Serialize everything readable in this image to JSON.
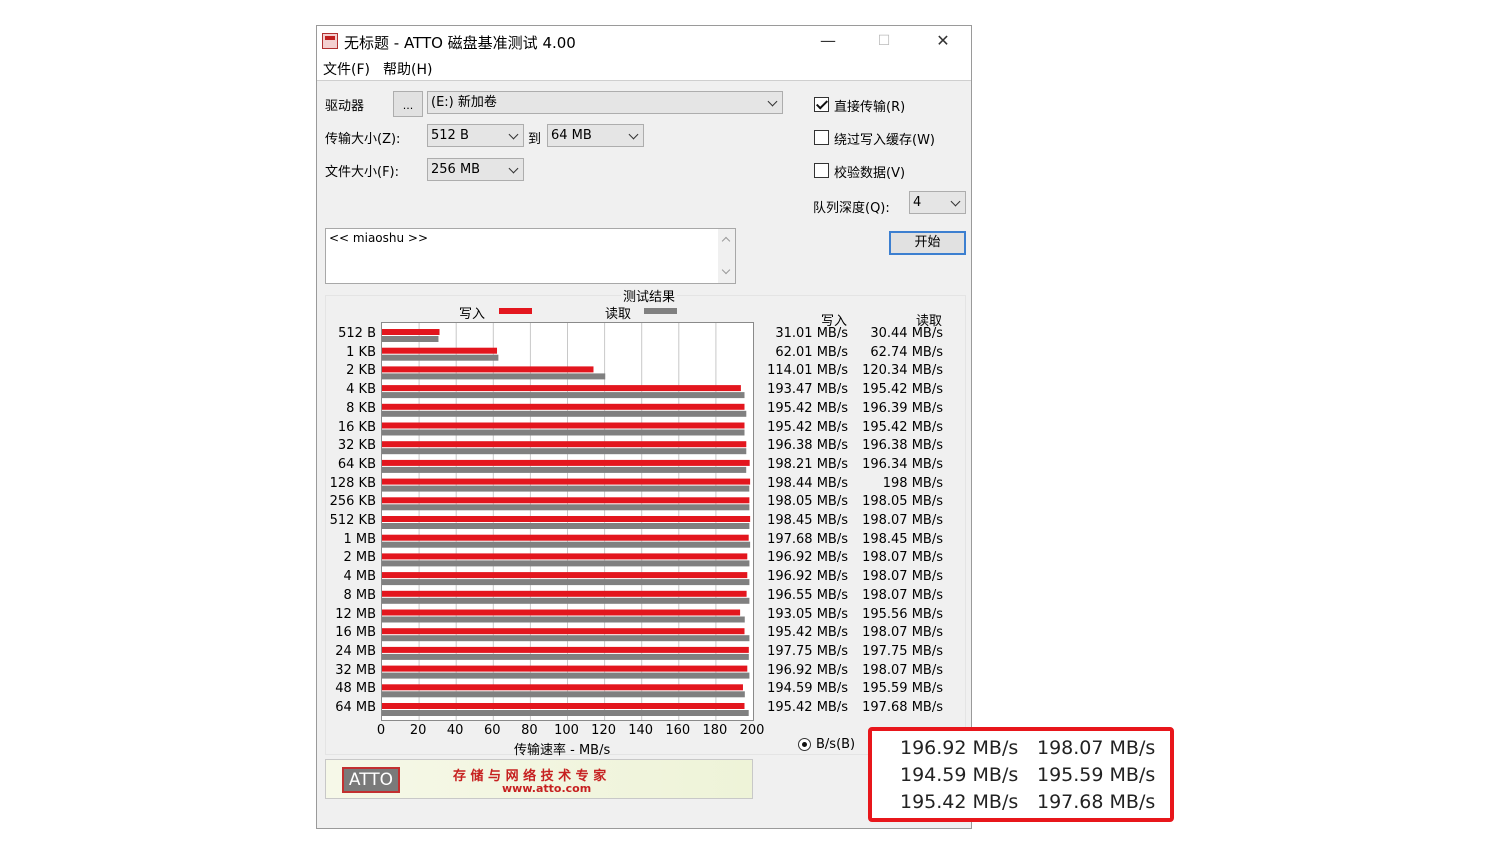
{
  "window": {
    "title": "无标题 - ATTO 磁盘基准测试 4.00",
    "minimize": "—",
    "maximize": "☐",
    "close": "✕"
  },
  "menu": {
    "file": "文件(F)",
    "help": "帮助(H)"
  },
  "settings": {
    "drive_label": "驱动器",
    "browse_button": "...",
    "drive_value": "(E:) 新加卷",
    "transfer_size_label": "传输大小(Z):",
    "transfer_from": "512 B",
    "to_label": "到",
    "transfer_to": "64 MB",
    "file_size_label": "文件大小(F):",
    "file_size": "256 MB",
    "direct_io_label": "直接传输(R)",
    "bypass_write_cache_label": "绕过写入缓存(W)",
    "verify_data_label": "校验数据(V)",
    "queue_depth_label": "队列深度(Q):",
    "queue_depth": "4",
    "start_button": "开始",
    "description": "<< miaoshu >>"
  },
  "results": {
    "title": "测试结果",
    "legend_write": "写入",
    "legend_read": "读取",
    "col_write": "写入",
    "col_read": "读取",
    "x_axis_label": "传输速率 - MB/s",
    "units_option": "B/s(B)",
    "write_color": "#e3161e",
    "read_color": "#808080"
  },
  "chart_data": {
    "type": "bar",
    "orientation": "horizontal",
    "title": "测试结果",
    "xlabel": "传输速率 - MB/s",
    "xlim": [
      0,
      200
    ],
    "x_ticks": [
      "0",
      "20",
      "40",
      "60",
      "80",
      "100",
      "120",
      "140",
      "160",
      "180",
      "200"
    ],
    "grid": true,
    "categories": [
      "512 B",
      "1 KB",
      "2 KB",
      "4 KB",
      "8 KB",
      "16 KB",
      "32 KB",
      "64 KB",
      "128 KB",
      "256 KB",
      "512 KB",
      "1 MB",
      "2 MB",
      "4 MB",
      "8 MB",
      "12 MB",
      "16 MB",
      "24 MB",
      "32 MB",
      "48 MB",
      "64 MB"
    ],
    "series": [
      {
        "name": "写入",
        "color": "#e3161e",
        "values": [
          31.01,
          62.01,
          114.01,
          193.47,
          195.42,
          195.42,
          196.38,
          198.21,
          198.44,
          198.05,
          198.45,
          197.68,
          196.92,
          196.92,
          196.55,
          193.05,
          195.42,
          197.75,
          196.92,
          194.59,
          195.42
        ],
        "labels": [
          "31.01 MB/s",
          "62.01 MB/s",
          "114.01 MB/s",
          "193.47 MB/s",
          "195.42 MB/s",
          "195.42 MB/s",
          "196.38 MB/s",
          "198.21 MB/s",
          "198.44 MB/s",
          "198.05 MB/s",
          "198.45 MB/s",
          "197.68 MB/s",
          "196.92 MB/s",
          "196.92 MB/s",
          "196.55 MB/s",
          "193.05 MB/s",
          "195.42 MB/s",
          "197.75 MB/s",
          "196.92 MB/s",
          "194.59 MB/s",
          "195.42 MB/s"
        ]
      },
      {
        "name": "读取",
        "color": "#808080",
        "values": [
          30.44,
          62.74,
          120.34,
          195.42,
          196.39,
          195.42,
          196.38,
          196.34,
          198,
          198.05,
          198.07,
          198.45,
          198.07,
          198.07,
          198.07,
          195.56,
          198.07,
          197.75,
          198.07,
          195.59,
          197.68
        ],
        "labels": [
          "30.44 MB/s",
          "62.74 MB/s",
          "120.34 MB/s",
          "195.42 MB/s",
          "196.39 MB/s",
          "195.42 MB/s",
          "196.38 MB/s",
          "196.34 MB/s",
          "198 MB/s",
          "198.05 MB/s",
          "198.07 MB/s",
          "198.45 MB/s",
          "198.07 MB/s",
          "198.07 MB/s",
          "198.07 MB/s",
          "195.56 MB/s",
          "198.07 MB/s",
          "197.75 MB/s",
          "198.07 MB/s",
          "195.59 MB/s",
          "197.68 MB/s"
        ]
      }
    ]
  },
  "banner": {
    "logo": "ATTO",
    "slogan": "存 储 与 网 络 技 术 专 家",
    "url": "www.atto.com"
  },
  "highlight": {
    "rows": [
      {
        "write": "196.92 MB/s",
        "read": "198.07 MB/s"
      },
      {
        "write": "194.59 MB/s",
        "read": "195.59 MB/s"
      },
      {
        "write": "195.42 MB/s",
        "read": "197.68 MB/s"
      }
    ],
    "border_color": "#e8161b"
  }
}
